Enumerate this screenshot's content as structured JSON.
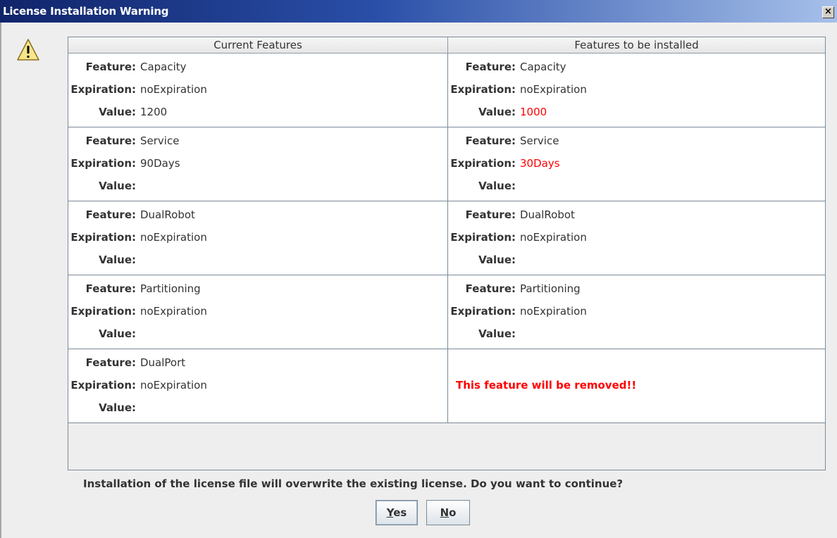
{
  "window": {
    "title": "License Installation Warning",
    "close_label": "×"
  },
  "table": {
    "headers": [
      "Current Features",
      "Features to be installed"
    ],
    "labels": {
      "feature": "Feature:",
      "expiration": "Expiration:",
      "value": "Value:"
    },
    "rows": [
      {
        "current": {
          "feature": "Capacity",
          "expiration": "noExpiration",
          "value": "1200"
        },
        "installed": {
          "feature": "Capacity",
          "expiration": "noExpiration",
          "value": "1000"
        }
      },
      {
        "current": {
          "feature": "Service",
          "expiration": "90Days",
          "value": ""
        },
        "installed": {
          "feature": "Service",
          "expiration": "30Days",
          "value": ""
        }
      },
      {
        "current": {
          "feature": "DualRobot",
          "expiration": "noExpiration",
          "value": ""
        },
        "installed": {
          "feature": "DualRobot",
          "expiration": "noExpiration",
          "value": ""
        }
      },
      {
        "current": {
          "feature": "Partitioning",
          "expiration": "noExpiration",
          "value": ""
        },
        "installed": {
          "feature": "Partitioning",
          "expiration": "noExpiration",
          "value": ""
        }
      },
      {
        "current": {
          "feature": "DualPort",
          "expiration": "noExpiration",
          "value": ""
        },
        "installed_message": "This feature will be removed!!"
      }
    ]
  },
  "message": "Installation of the license file will overwrite the existing license.  Do you want to continue?",
  "buttons": {
    "yes_mnemonic": "Y",
    "yes_rest": "es",
    "no_mnemonic": "N",
    "no_rest": "o"
  },
  "colors": {
    "changed": "#ff0000",
    "titlebar": "#10246a"
  },
  "icons": {
    "dialog": "warning-icon"
  }
}
